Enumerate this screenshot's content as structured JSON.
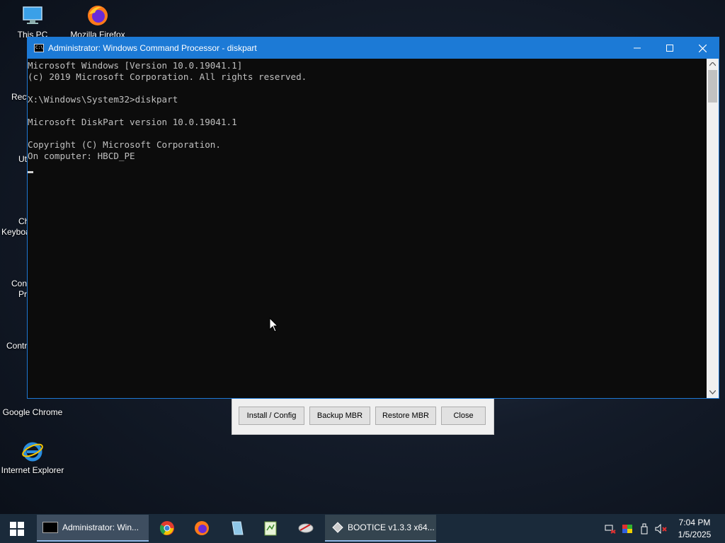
{
  "desktop": {
    "icons": [
      {
        "label": "This PC"
      },
      {
        "label": "Mozilla Firefox"
      },
      {
        "label": "Google Chrome"
      },
      {
        "label": "Internet Explorer"
      }
    ],
    "partial_labels": {
      "recycle": "Recy",
      "utilities": "Ut",
      "keyboard_1": "Ch",
      "keyboard_2": "Keyboa",
      "command_1": "Con",
      "command_2": "Pr",
      "control": "Contr"
    }
  },
  "cmd_window": {
    "title": "Administrator: Windows Command Processor - diskpart",
    "buttons": {
      "minimize": "—",
      "maximize": "☐",
      "close": "✕"
    },
    "lines": [
      "Microsoft Windows [Version 10.0.19041.1]",
      "(c) 2019 Microsoft Corporation. All rights reserved.",
      "",
      "X:\\Windows\\System32>diskpart",
      "",
      "Microsoft DiskPart version 10.0.19041.1",
      "",
      "Copyright (C) Microsoft Corporation.",
      "On computer: HBCD_PE"
    ]
  },
  "bootice_dialog": {
    "buttons": [
      "Install / Config",
      "Backup MBR",
      "Restore MBR",
      "Close"
    ]
  },
  "taskbar": {
    "cmd_task_label": "Administrator: Win...",
    "bootice_task_label": "BOOTICE v1.3.3 x64...",
    "clock_time": "7:04 PM",
    "clock_date": "1/5/2025"
  },
  "colors": {
    "titlebar": "#1c7ad6",
    "console_bg": "#0c0c0c",
    "console_text": "#c0c0c0",
    "taskbar": "#1a2a3a"
  }
}
